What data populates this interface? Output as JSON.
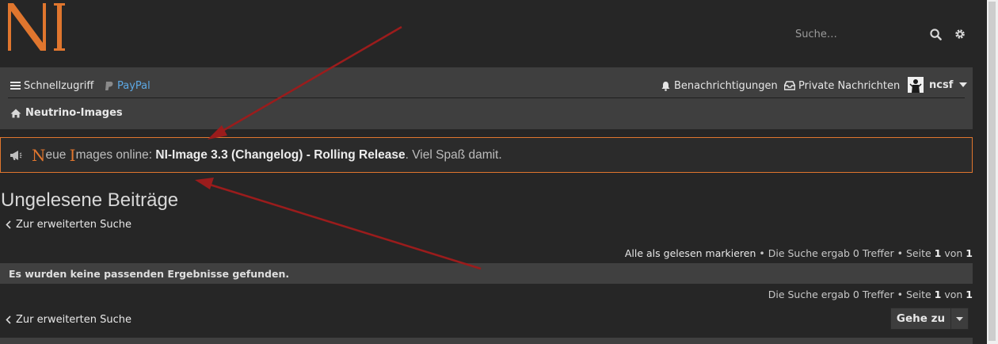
{
  "header": {
    "logo_text": "NI",
    "search": {
      "placeholder": "Suche…"
    }
  },
  "navbar": {
    "quick_access_label": "Schnellzugriff",
    "paypal_label": "PayPal",
    "notifications_label": "Benachrichtigungen",
    "private_messages_label": "Private Nachrichten",
    "username": "ncsf",
    "breadcrumb_label": "Neutrino-Images"
  },
  "announcement": {
    "cap1": "N",
    "rest1": "eue ",
    "cap2": "I",
    "rest2": "mages online: ",
    "highlight": "NI-Image 3.3 (Changelog) - Rolling Release",
    "tail": ". Viel Spaß damit."
  },
  "page": {
    "title": "Ungelesene Beiträge",
    "back_link": "Zur erweiterten Suche",
    "mark_read": "Alle als gelesen markieren",
    "separator": " • ",
    "result_count": "Die Suche ergab 0 Treffer",
    "page_prefix": "Seite",
    "page_current": "1",
    "page_of": "von",
    "page_total": "1",
    "no_results": "Es wurden keine passenden Ergebnisse gefunden.",
    "goto_label": "Gehe zu"
  },
  "colors": {
    "accent": "#e0762e",
    "arrow": "#9b1c1c",
    "link": "#5ca8e4"
  }
}
